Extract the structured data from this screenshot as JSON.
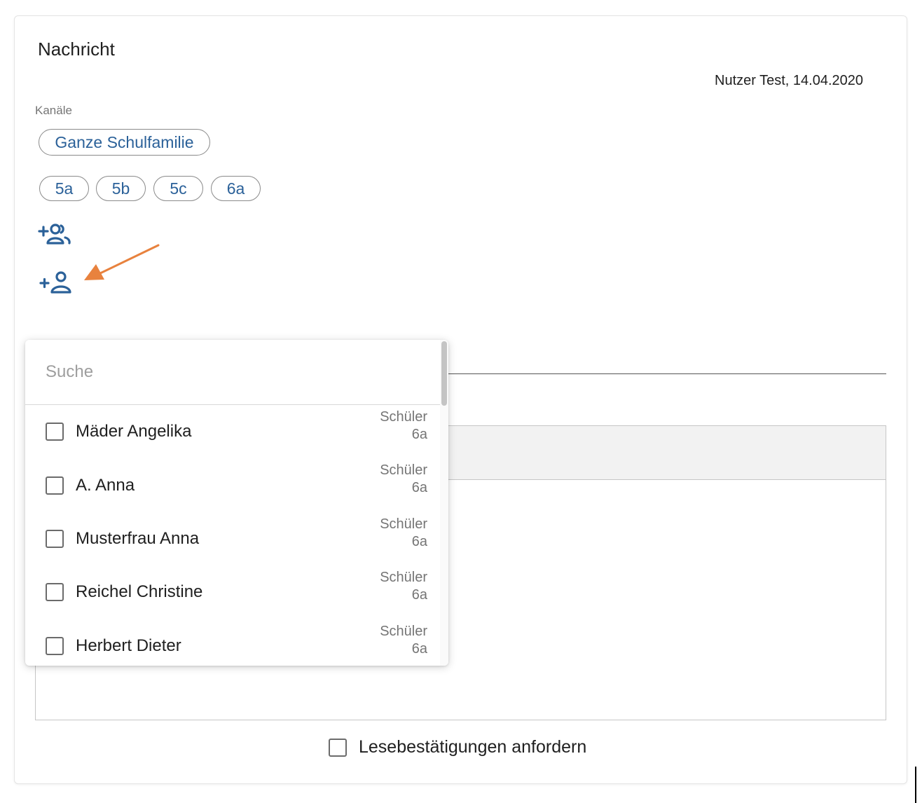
{
  "message": {
    "title": "Nachricht",
    "author_line": "Nutzer Test, 14.04.2020",
    "channels_label": "Kanäle",
    "main_channel": "Ganze Schulfamilie",
    "class_channels": [
      "5a",
      "5b",
      "5c",
      "6a"
    ]
  },
  "icons": {
    "add_group": "add-group-icon",
    "add_person": "add-person-icon",
    "annotation": "arrow-annotation"
  },
  "dropdown": {
    "search_placeholder": "Suche",
    "items": [
      {
        "name": "Mäder Angelika",
        "role": "Schüler",
        "class": "6a",
        "checked": false
      },
      {
        "name": "A. Anna",
        "role": "Schüler",
        "class": "6a",
        "checked": false
      },
      {
        "name": "Musterfrau Anna",
        "role": "Schüler",
        "class": "6a",
        "checked": false
      },
      {
        "name": "Reichel Christine",
        "role": "Schüler",
        "class": "6a",
        "checked": false
      },
      {
        "name": "Herbert Dieter",
        "role": "Schüler",
        "class": "6a",
        "checked": false
      }
    ]
  },
  "read_receipt": {
    "label": "Lesebestätigungen anfordern",
    "checked": false
  },
  "colors": {
    "accent": "#2b6199",
    "annotation_arrow": "#e8823e"
  }
}
